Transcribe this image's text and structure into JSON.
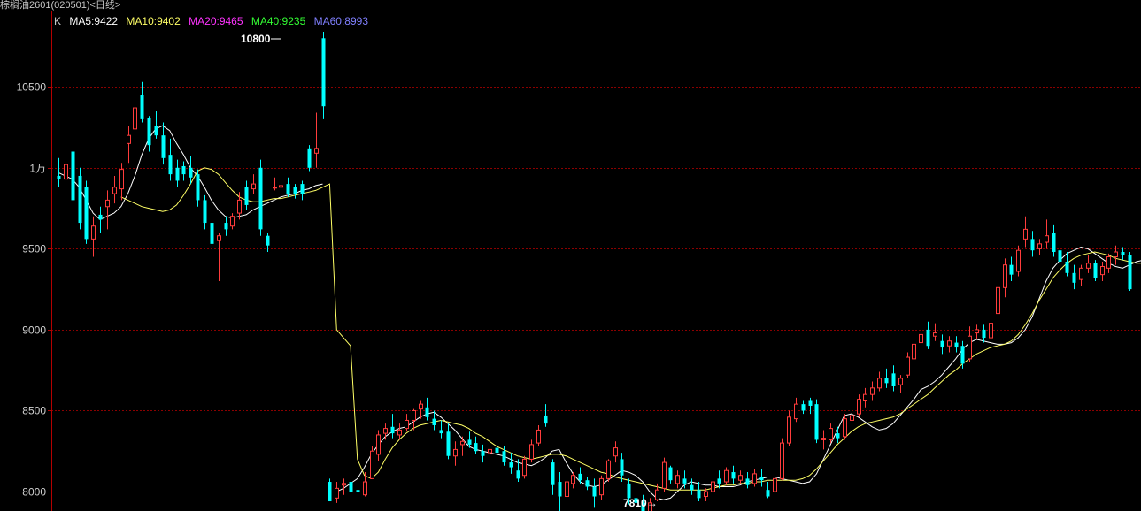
{
  "title": "棕榈油2601(020501)<日线>",
  "legend": {
    "k_label": "K",
    "items": [
      {
        "label": "MA5:9422",
        "color": "#ffffff"
      },
      {
        "label": "MA10:9402",
        "color": "#ffff66"
      },
      {
        "label": "MA20:9465",
        "color": "#ff33ff"
      },
      {
        "label": "MA40:9235",
        "color": "#33ff33"
      },
      {
        "label": "MA60:8993",
        "color": "#8080ff"
      }
    ]
  },
  "annotations": {
    "high": "10800",
    "low": "7810→"
  },
  "colors": {
    "up": "#ff3c3c",
    "down": "#00ffff",
    "grid": "#8b0000",
    "axis": "#b40000"
  },
  "chart_data": {
    "type": "candlestick",
    "title": "棕榈油2601(020501)<日线>",
    "y_ticks": [
      {
        "value": 10500,
        "label": "10500"
      },
      {
        "value": 10000,
        "label": "1万"
      },
      {
        "value": 9500,
        "label": "9500"
      },
      {
        "value": 9000,
        "label": "9000"
      },
      {
        "value": 8500,
        "label": "8500"
      },
      {
        "value": 8000,
        "label": "8000"
      }
    ],
    "ylim": [
      7880,
      10960
    ],
    "grid": true,
    "candles": [
      [
        9950,
        10060,
        9880,
        9930
      ],
      [
        9930,
        10050,
        9850,
        10020
      ],
      [
        10100,
        10180,
        9700,
        9800
      ],
      [
        9950,
        10000,
        9620,
        9660
      ],
      [
        9880,
        9920,
        9530,
        9560
      ],
      [
        9560,
        9700,
        9450,
        9640
      ],
      [
        9710,
        9760,
        9600,
        9680
      ],
      [
        9760,
        9860,
        9620,
        9800
      ],
      [
        9840,
        9950,
        9780,
        9880
      ],
      [
        9870,
        10030,
        9800,
        9990
      ],
      [
        10150,
        10260,
        10030,
        10200
      ],
      [
        10240,
        10420,
        10180,
        10370
      ],
      [
        10450,
        10530,
        10280,
        10300
      ],
      [
        10310,
        10320,
        10100,
        10140
      ],
      [
        10260,
        10350,
        10180,
        10200
      ],
      [
        10200,
        10280,
        10020,
        10060
      ],
      [
        10080,
        10180,
        9920,
        9960
      ],
      [
        10000,
        10050,
        9880,
        9920
      ],
      [
        10010,
        10040,
        9920,
        9960
      ],
      [
        10000,
        10070,
        9900,
        9940
      ],
      [
        9960,
        9990,
        9760,
        9800
      ],
      [
        9800,
        9830,
        9620,
        9660
      ],
      [
        9660,
        9710,
        9480,
        9530
      ],
      [
        9550,
        9600,
        9300,
        9580
      ],
      [
        9660,
        9700,
        9580,
        9620
      ],
      [
        9640,
        9720,
        9620,
        9700
      ],
      [
        9720,
        9850,
        9680,
        9800
      ],
      [
        9880,
        9920,
        9740,
        9770
      ],
      [
        9870,
        9960,
        9840,
        9900
      ],
      [
        10000,
        10050,
        9580,
        9620
      ],
      [
        9580,
        9600,
        9480,
        9520
      ],
      [
        9880,
        9940,
        9860,
        9880
      ],
      [
        9880,
        9960,
        9860,
        9890
      ],
      [
        9900,
        9940,
        9820,
        9840
      ],
      [
        9880,
        9900,
        9810,
        9840
      ],
      [
        9900,
        9920,
        9800,
        9840
      ],
      [
        10120,
        10140,
        9980,
        10000
      ],
      [
        10090,
        10340,
        10000,
        10120
      ],
      [
        10800,
        10840,
        10300,
        10380
      ],
      [
        8060,
        8080,
        7940,
        7940
      ],
      [
        7960,
        8060,
        7930,
        8020
      ],
      [
        8040,
        8080,
        7980,
        8050
      ],
      [
        8060,
        8090,
        7950,
        8000
      ],
      [
        8010,
        8030,
        7970,
        8000
      ],
      [
        7980,
        8120,
        7970,
        8060
      ],
      [
        8080,
        8280,
        8080,
        8250
      ],
      [
        8230,
        8380,
        8190,
        8350
      ],
      [
        8360,
        8420,
        8320,
        8390
      ],
      [
        8400,
        8480,
        8330,
        8360
      ],
      [
        8350,
        8420,
        8320,
        8380
      ],
      [
        8390,
        8480,
        8370,
        8440
      ],
      [
        8440,
        8510,
        8380,
        8500
      ],
      [
        8510,
        8560,
        8450,
        8540
      ],
      [
        8520,
        8580,
        8440,
        8460
      ],
      [
        8450,
        8500,
        8380,
        8410
      ],
      [
        8380,
        8440,
        8330,
        8360
      ],
      [
        8370,
        8420,
        8200,
        8220
      ],
      [
        8220,
        8310,
        8160,
        8260
      ],
      [
        8290,
        8340,
        8220,
        8310
      ],
      [
        8320,
        8370,
        8270,
        8290
      ],
      [
        8300,
        8340,
        8230,
        8250
      ],
      [
        8250,
        8290,
        8180,
        8220
      ],
      [
        8240,
        8300,
        8200,
        8260
      ],
      [
        8270,
        8300,
        8220,
        8240
      ],
      [
        8250,
        8280,
        8160,
        8180
      ],
      [
        8180,
        8240,
        8110,
        8150
      ],
      [
        8130,
        8200,
        8060,
        8080
      ],
      [
        8100,
        8220,
        8080,
        8200
      ],
      [
        8200,
        8320,
        8180,
        8290
      ],
      [
        8300,
        8410,
        8280,
        8380
      ],
      [
        8470,
        8540,
        8400,
        8420
      ],
      [
        8180,
        8200,
        7980,
        8040
      ],
      [
        8060,
        8120,
        7820,
        7970
      ],
      [
        7970,
        8090,
        7940,
        8060
      ],
      [
        8050,
        8120,
        8020,
        8100
      ],
      [
        8110,
        8150,
        8050,
        8070
      ],
      [
        8070,
        8090,
        8010,
        8030
      ],
      [
        8030,
        8080,
        7900,
        7970
      ],
      [
        7980,
        8100,
        7950,
        8080
      ],
      [
        8080,
        8200,
        8060,
        8190
      ],
      [
        8220,
        8310,
        8180,
        8270
      ],
      [
        8200,
        8240,
        8060,
        8100
      ],
      [
        8050,
        8080,
        7920,
        7960
      ],
      [
        7960,
        8020,
        7900,
        7930
      ],
      [
        7930,
        7980,
        7840,
        7870
      ],
      [
        7870,
        7960,
        7810,
        7930
      ],
      [
        7950,
        8050,
        7940,
        8010
      ],
      [
        8020,
        8210,
        8000,
        8180
      ],
      [
        8150,
        8160,
        8050,
        8070
      ],
      [
        8050,
        8130,
        8020,
        8100
      ],
      [
        8080,
        8130,
        8020,
        8050
      ],
      [
        8040,
        8080,
        7980,
        8010
      ],
      [
        8010,
        8060,
        7940,
        7960
      ],
      [
        7970,
        8020,
        7940,
        8000
      ],
      [
        8000,
        8100,
        7990,
        8060
      ],
      [
        8080,
        8130,
        8020,
        8050
      ],
      [
        8060,
        8150,
        8040,
        8130
      ],
      [
        8120,
        8160,
        8050,
        8080
      ],
      [
        8070,
        8130,
        8050,
        8100
      ],
      [
        8080,
        8120,
        8020,
        8040
      ],
      [
        8050,
        8140,
        8030,
        8110
      ],
      [
        8090,
        8140,
        8030,
        8070
      ],
      [
        8010,
        8060,
        7960,
        7970
      ],
      [
        8000,
        8100,
        7990,
        8080
      ],
      [
        8080,
        8330,
        8070,
        8300
      ],
      [
        8300,
        8500,
        8280,
        8460
      ],
      [
        8450,
        8580,
        8430,
        8540
      ],
      [
        8540,
        8560,
        8480,
        8500
      ],
      [
        8560,
        8580,
        8480,
        8530
      ],
      [
        8540,
        8570,
        8300,
        8320
      ],
      [
        8320,
        8380,
        8260,
        8330
      ],
      [
        8320,
        8420,
        8300,
        8390
      ],
      [
        8360,
        8400,
        8300,
        8330
      ],
      [
        8340,
        8480,
        8320,
        8450
      ],
      [
        8440,
        8500,
        8400,
        8470
      ],
      [
        8480,
        8600,
        8460,
        8570
      ],
      [
        8560,
        8640,
        8520,
        8600
      ],
      [
        8600,
        8680,
        8560,
        8640
      ],
      [
        8640,
        8740,
        8620,
        8700
      ],
      [
        8700,
        8760,
        8640,
        8670
      ],
      [
        8730,
        8780,
        8620,
        8650
      ],
      [
        8660,
        8720,
        8610,
        8700
      ],
      [
        8720,
        8860,
        8700,
        8830
      ],
      [
        8820,
        8940,
        8800,
        8910
      ],
      [
        8920,
        9020,
        8880,
        8970
      ],
      [
        9000,
        9050,
        8880,
        8900
      ],
      [
        8960,
        9040,
        8930,
        8980
      ],
      [
        8930,
        8970,
        8850,
        8890
      ],
      [
        8900,
        8960,
        8860,
        8930
      ],
      [
        8920,
        8960,
        8860,
        8890
      ],
      [
        8900,
        8930,
        8760,
        8790
      ],
      [
        8820,
        9020,
        8800,
        8960
      ],
      [
        8980,
        9030,
        8940,
        9000
      ],
      [
        9000,
        9030,
        8920,
        8950
      ],
      [
        8950,
        9070,
        8920,
        9040
      ],
      [
        9100,
        9280,
        9080,
        9260
      ],
      [
        9260,
        9440,
        9200,
        9400
      ],
      [
        9400,
        9450,
        9300,
        9340
      ],
      [
        9360,
        9520,
        9330,
        9490
      ],
      [
        9560,
        9700,
        9510,
        9620
      ],
      [
        9560,
        9610,
        9450,
        9490
      ],
      [
        9500,
        9560,
        9460,
        9530
      ],
      [
        9540,
        9680,
        9500,
        9580
      ],
      [
        9600,
        9650,
        9450,
        9480
      ],
      [
        9490,
        9520,
        9400,
        9420
      ],
      [
        9420,
        9480,
        9330,
        9350
      ],
      [
        9350,
        9400,
        9250,
        9290
      ],
      [
        9310,
        9400,
        9270,
        9380
      ],
      [
        9380,
        9460,
        9350,
        9410
      ],
      [
        9410,
        9430,
        9300,
        9320
      ],
      [
        9340,
        9420,
        9300,
        9390
      ],
      [
        9380,
        9470,
        9350,
        9450
      ],
      [
        9450,
        9520,
        9400,
        9480
      ],
      [
        9480,
        9510,
        9430,
        9460
      ],
      [
        9460,
        9480,
        9240,
        9250
      ]
    ],
    "ma": {
      "MA5": [
        9970,
        9950,
        9930,
        9880,
        9800,
        9720,
        9680,
        9700,
        9720,
        9760,
        9840,
        9950,
        10080,
        10180,
        10240,
        10260,
        10230,
        10150,
        10080,
        10000,
        9950,
        9880,
        9800,
        9740,
        9700,
        9690,
        9700,
        9710,
        9740,
        9760,
        9780,
        9800,
        9820,
        9830,
        9840,
        9860,
        9870,
        9890,
        9900,
        null,
        8000,
        8020,
        8050,
        8080,
        8150,
        8230,
        8290,
        8340,
        8370,
        8390,
        8400,
        8430,
        8460,
        8480,
        8490,
        8460,
        8420,
        8380,
        8330,
        8280,
        8260,
        8250,
        8240,
        8230,
        8220,
        8200,
        8180,
        8170,
        8160,
        8180,
        8210,
        8250,
        8260,
        8180,
        8110,
        8060,
        8040,
        8030,
        8040,
        8070,
        8100,
        8130,
        8120,
        8100,
        8060,
        8000,
        7960,
        7950,
        7960,
        8000,
        8040,
        8060,
        8050,
        8040,
        8040,
        8030,
        8030,
        8030,
        8040,
        8060,
        8070,
        8080,
        8090,
        8090,
        8080,
        8070,
        8060,
        8050,
        8060,
        8110,
        8200,
        8290,
        8380,
        8470,
        8480,
        8460,
        8430,
        8400,
        8380,
        8390,
        8420,
        8470,
        8520,
        8570,
        8630,
        8650,
        8680,
        8720,
        8770,
        8820,
        8880,
        8920,
        8940,
        8930,
        8920,
        8910,
        8910,
        8920,
        8950,
        9000,
        9080,
        9190,
        9300,
        9380,
        9430,
        9470,
        9490,
        9510,
        9500,
        9470,
        9440,
        9410,
        9390,
        9380,
        9400,
        9420,
        9430,
        9420
      ],
      "MA10": [
        null,
        null,
        null,
        null,
        null,
        null,
        null,
        null,
        null,
        9820,
        9800,
        9780,
        9760,
        9750,
        9740,
        9730,
        9740,
        9770,
        9830,
        9900,
        9980,
        10000,
        9990,
        9960,
        9910,
        9860,
        9820,
        9800,
        9790,
        9790,
        9800,
        9810,
        9810,
        9820,
        9830,
        9840,
        9850,
        9860,
        9880,
        9900,
        9000,
        8950,
        8900,
        8200,
        8100,
        8080,
        8120,
        8200,
        8270,
        8320,
        8360,
        8390,
        8410,
        8420,
        8430,
        8440,
        8430,
        8420,
        8410,
        8390,
        8360,
        8340,
        8310,
        8280,
        8260,
        8240,
        8220,
        8210,
        8200,
        8210,
        8220,
        8230,
        8230,
        8220,
        8200,
        8180,
        8160,
        8140,
        8120,
        8110,
        8090,
        8080,
        8070,
        8060,
        8050,
        8040,
        8030,
        8020,
        8010,
        8010,
        8010,
        8010,
        8010,
        8010,
        8020,
        8030,
        8040,
        8040,
        8050,
        8050,
        8060,
        8060,
        8070,
        8070,
        8070,
        8070,
        8070,
        8080,
        8100,
        8140,
        8190,
        8240,
        8290,
        8330,
        8370,
        8400,
        8420,
        8430,
        8440,
        8450,
        8460,
        8480,
        8510,
        8540,
        8570,
        8600,
        8640,
        8680,
        8720,
        8750,
        8790,
        8820,
        8850,
        8870,
        8890,
        8900,
        8910,
        8930,
        8970,
        9030,
        9100,
        9180,
        9250,
        9320,
        9370,
        9410,
        9440,
        9460,
        9470,
        9480,
        9470,
        9460,
        9440,
        9430,
        9420,
        9410,
        9410,
        9400
      ]
    }
  }
}
